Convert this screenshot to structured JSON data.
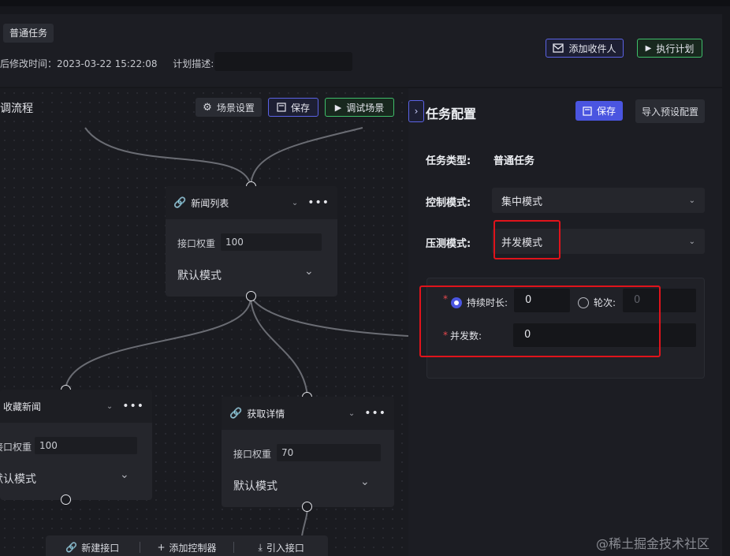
{
  "header": {
    "task_tag": "普通任务",
    "modified_label": "后修改时间：",
    "modified_time": "2023-03-22 15:22:08",
    "plan_desc_label": "计划描述:",
    "add_recipient": "添加收件人",
    "execute_plan": "执行计划"
  },
  "flow": {
    "title": "调流程",
    "scene_settings": "场景设置",
    "save": "保存",
    "debug_scene": "调试场景",
    "nodes": [
      {
        "name": "新闻列表",
        "weight_label": "接口权重",
        "weight": "100",
        "mode": "默认模式"
      },
      {
        "name": "收藏新闻",
        "weight_label": "接口权重",
        "weight": "100",
        "mode": "默认模式"
      },
      {
        "name": "获取详情",
        "weight_label": "接口权重",
        "weight": "70",
        "mode": "默认模式"
      }
    ],
    "bottom_actions": [
      "新建接口",
      "添加控制器",
      "引入接口"
    ]
  },
  "config": {
    "title": "任务配置",
    "save": "保存",
    "import_preset": "导入预设配置",
    "task_type_label": "任务类型:",
    "task_type_value": "普通任务",
    "control_mode_label": "控制模式:",
    "control_mode_value": "集中模式",
    "stress_mode_label": "压测模式:",
    "stress_mode_value": "并发模式",
    "duration_label": "持续时长:",
    "duration_value": "0",
    "rounds_label": "轮次:",
    "rounds_value": "0",
    "concurrency_label": "并发数:",
    "concurrency_value": "0",
    "required_mark": "*"
  },
  "watermark": "@稀土掘金技术社区",
  "colors": {
    "accent": "#4a55e0",
    "green": "#3fbf6a",
    "highlight": "#e0131b"
  }
}
